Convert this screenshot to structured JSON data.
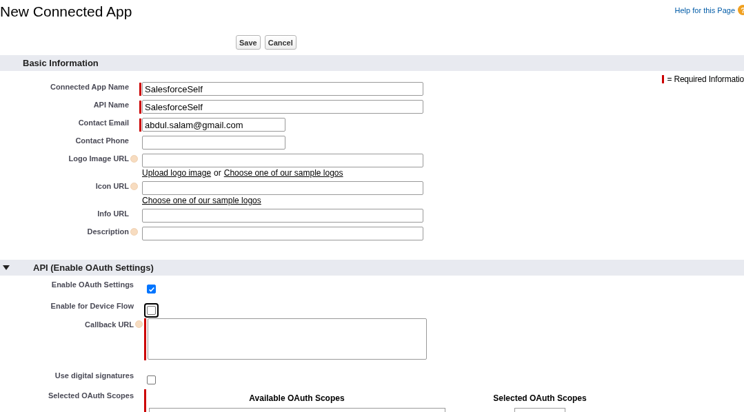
{
  "page": {
    "title": "New Connected App",
    "help_link": "Help for this Page",
    "help_icon": "?"
  },
  "buttons": [
    "Save",
    "Cancel"
  ],
  "basic": {
    "title": "Basic Information",
    "required_legend": "= Required Informatio",
    "fields": [
      {
        "kind": "long",
        "label": "Connected App Name",
        "value": "SalesforceSelf",
        "required": true,
        "help": false
      },
      {
        "kind": "long",
        "label": "API Name",
        "value": "SalesforceSelf",
        "required": true,
        "help": false
      },
      {
        "kind": "short",
        "label": "Contact Email",
        "value": "abdul.salam@gmail.com",
        "required": true,
        "help": false
      },
      {
        "kind": "short",
        "label": "Contact Phone",
        "required": false,
        "help": false
      },
      {
        "kind": "long",
        "label": "Logo Image URL",
        "required": false,
        "help": true,
        "note": [
          {
            "text": "Upload logo image",
            "link": true
          },
          {
            "text": "or",
            "link": false
          },
          {
            "text": "Choose one of our sample logos",
            "link": true
          }
        ]
      },
      {
        "kind": "long",
        "label": "Icon URL",
        "required": false,
        "help": true,
        "note": [
          {
            "text": "Choose one of our sample logos",
            "link": true
          }
        ]
      },
      {
        "kind": "long",
        "label": "Info URL",
        "required": false,
        "help": false
      },
      {
        "kind": "long",
        "label": "Description",
        "required": false,
        "help": true
      }
    ]
  },
  "api": {
    "title": "API (Enable OAuth Settings)",
    "expanded": true,
    "fields": [
      {
        "kind": "checkbox",
        "label": "Enable OAuth Settings",
        "checked": true,
        "focused": false,
        "help": false,
        "required": false
      },
      {
        "kind": "checkbox",
        "label": "Enable for Device Flow",
        "checked": false,
        "focused": true,
        "help": false,
        "required": false
      },
      {
        "kind": "textarea",
        "label": "Callback URL",
        "help": true,
        "required": true
      },
      {
        "kind": "checkbox",
        "label": "Use digital signatures",
        "checked": false,
        "focused": false,
        "help": false,
        "required": false
      },
      {
        "kind": "scopes",
        "label": "Selected OAuth Scopes",
        "help": false,
        "required": true,
        "available_title": "Available OAuth Scopes",
        "selected_title": "Selected OAuth Scopes"
      }
    ]
  }
}
